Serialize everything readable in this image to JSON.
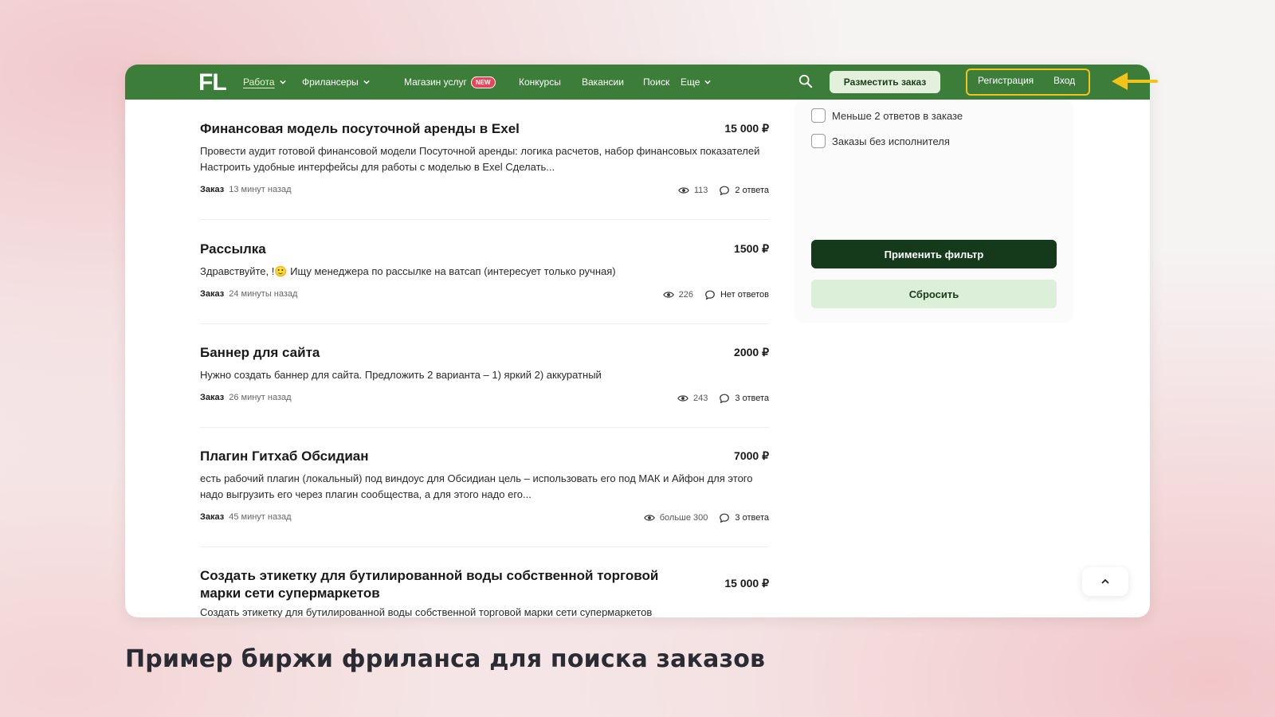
{
  "navbar": {
    "logo": "FL",
    "items": [
      {
        "label": "Работа",
        "has_dropdown": true,
        "active": true
      },
      {
        "label": "Фрилансеры",
        "has_dropdown": true
      },
      {
        "label": "Магазин услуг",
        "badge": "NEW"
      },
      {
        "label": "Конкурсы"
      },
      {
        "label": "Вакансии"
      },
      {
        "label": "Поиск"
      },
      {
        "label": "Еще",
        "has_dropdown": true
      }
    ],
    "search_icon": "search-icon",
    "place_order": "Разместить заказ",
    "register": "Регистрация",
    "login": "Вход",
    "highlight_color": "#f2c318",
    "brand_color": "#3d7d3a"
  },
  "orders": [
    {
      "title": "Финансовая модель посуточной аренды в Exel",
      "price": "15 000 ₽",
      "description": "Провести аудит готовой финансовой модели Посуточной аренды: логика расчетов, набор финансовых показателей  Настроить удобные интерфейсы для работы с моделью в Exel  Сделать...",
      "type": "Заказ",
      "time": "13 минут назад",
      "views": "113",
      "answers": "2 ответа"
    },
    {
      "title": "Рассылка",
      "price": "1500 ₽",
      "description": "Здравствуйте, !🙂 Ищу менеджера по рассылке на ватсап (интересует только ручная)",
      "type": "Заказ",
      "time": "24 минуты назад",
      "views": "226",
      "answers": "Нет ответов"
    },
    {
      "title": "Баннер для сайта",
      "price": "2000 ₽",
      "description": "Нужно создать баннер для сайта. Предложить 2 варианта – 1) яркий 2) аккуратный",
      "type": "Заказ",
      "time": "26 минут назад",
      "views": "243",
      "answers": "3 ответа"
    },
    {
      "title": "Плагин Гитхаб Обсидиан",
      "price": "7000 ₽",
      "description": "есть рабочий плагин (локальный) под виндоус для Обсидиан цель – использовать его под МАК и Айфон для этого надо выгрузить его через плагин сообщества, а для этого надо его...",
      "type": "Заказ",
      "time": "45 минут назад",
      "views": "больше 300",
      "answers": "3 ответа"
    },
    {
      "title": "Создать этикетку для бутилированной воды собственной торговой марки сети супермаркетов",
      "price": "15 000 ₽",
      "description": "Создать этикетку для бутилированной воды собственной торговой марки сети супермаркетов"
    }
  ],
  "filters": {
    "checkboxes": [
      {
        "label": "Меньше 2 ответов в заказе",
        "checked": false
      },
      {
        "label": "Заказы без исполнителя",
        "checked": false
      }
    ],
    "apply": "Применить фильтр",
    "reset": "Сбросить"
  },
  "scroll_top_icon": "chevron-up-icon",
  "caption": "Пример биржи фриланса для поиска заказов"
}
